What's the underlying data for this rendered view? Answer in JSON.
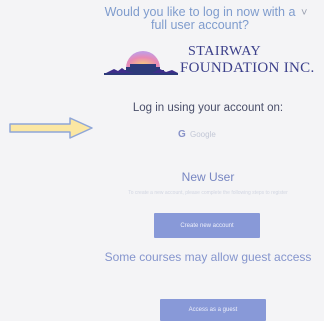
{
  "dialog": {
    "headline": "Would you like to log in now with a full user account?",
    "close_glyph": "˅"
  },
  "logo": {
    "line1": "STAIRWAY",
    "line2": "FOUNDATION INC."
  },
  "login": {
    "heading": "Log in using your account on:",
    "provider_label": "Google",
    "provider_icon": "google-icon"
  },
  "new_user": {
    "heading": "New User",
    "description": "To create a new account, please complete the following steps to register",
    "create_label": "Create new account"
  },
  "guest": {
    "heading": "Some courses may allow guest access",
    "button_label": "Access as a guest"
  },
  "colors": {
    "accent": "#8899d8",
    "heading": "#7f9ccd",
    "arrow": "#f2c75c"
  }
}
